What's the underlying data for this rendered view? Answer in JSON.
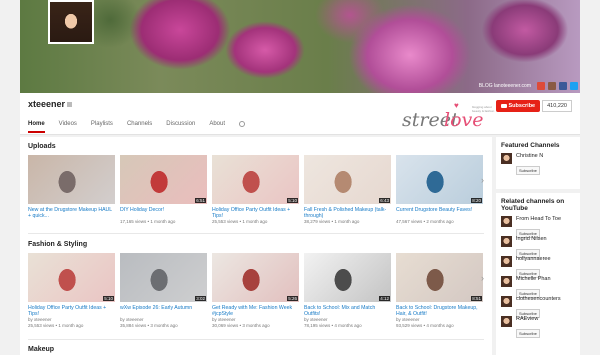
{
  "banner": {
    "blog_text": "BLOG lanoteeener.com",
    "social": [
      "g+",
      "ig",
      "f",
      "tw"
    ]
  },
  "channel": {
    "name": "xteeener",
    "tabs": [
      "Home",
      "Videos",
      "Playlists",
      "Channels",
      "Discussion",
      "About"
    ],
    "active_tab": "Home",
    "subscribe_label": "Subscribe",
    "subscriber_count": "410,220",
    "logo_street": "street",
    "logo_love": "love",
    "logo_tagline": "blogging about beauty & fashion"
  },
  "sections": [
    {
      "title": "Uploads",
      "videos": [
        {
          "title": "New at the Drugstore Makeup HAUL + quick...",
          "meta1": "",
          "meta2": "",
          "duration": "",
          "colors": [
            "#c9b6a8",
            "#7a6c6a"
          ]
        },
        {
          "title": "DIY Holiday Decor!",
          "meta1": "17,165 views • 1 month ago",
          "meta2": "",
          "duration": "6:51",
          "colors": [
            "#d6c8b8",
            "#c23a3a"
          ]
        },
        {
          "title": "Holiday Office Party Outfit Ideas + Tips!",
          "meta1": "25,553 views • 1 month ago",
          "meta2": "",
          "duration": "5:10",
          "colors": [
            "#e9e1d6",
            "#c0504d"
          ]
        },
        {
          "title": "Fall Fresh & Polished Makeup (talk-through)",
          "meta1": "38,279 views • 1 month ago",
          "meta2": "",
          "duration": "6:43",
          "colors": [
            "#eee6df",
            "#b58a72"
          ]
        },
        {
          "title": "Current Drugstore Beauty Faves!",
          "meta1": "47,567 views • 2 months ago",
          "meta2": "",
          "duration": "8:20",
          "colors": [
            "#d9e3ec",
            "#2f6a96"
          ]
        }
      ]
    },
    {
      "title": "Fashion & Styling",
      "videos": [
        {
          "title": "Holiday Office Party Outfit Ideas + Tips!",
          "meta1": "by xteeener",
          "meta2": "25,553 views • 1 month ago",
          "duration": "5:10",
          "colors": [
            "#e9e1d6",
            "#c0504d"
          ]
        },
        {
          "title": "wXw Episode 26: Early Autumn",
          "meta1": "by xteeener",
          "meta2": "35,884 views • 3 months ago",
          "duration": "3:02",
          "colors": [
            "#b9bcc0",
            "#6c6e72"
          ]
        },
        {
          "title": "Get Ready with Me: Fashion Week #jcpStyle",
          "meta1": "by xteeener",
          "meta2": "30,069 views • 3 months ago",
          "duration": "5:26",
          "colors": [
            "#ece7e2",
            "#a7413d"
          ]
        },
        {
          "title": "Back to School: Mix and Match Outfits!",
          "meta1": "by xteeener",
          "meta2": "78,195 views • 4 months ago",
          "duration": "4:12",
          "colors": [
            "#f2f2f2",
            "#4c4c4c"
          ]
        },
        {
          "title": "Back to School: Drugstore Makeup, Hair, & Outfit!",
          "meta1": "by xteeener",
          "meta2": "93,529 views • 4 months ago",
          "duration": "8:51",
          "colors": [
            "#e7ddd2",
            "#7d5a4a"
          ]
        }
      ]
    },
    {
      "title": "Makeup",
      "videos": []
    }
  ],
  "featured": {
    "title": "Featured Channels",
    "channels": [
      {
        "name": "Christine N",
        "btn": "Subscribe"
      }
    ]
  },
  "related": {
    "title": "Related channels on YouTube",
    "channels": [
      {
        "name": "From Head To Toe",
        "btn": "Subscribe"
      },
      {
        "name": "Ingrid Nilsen",
        "btn": "Subscribe"
      },
      {
        "name": "hollyannaeree",
        "btn": "Subscribe"
      },
      {
        "name": "Michelle Phan",
        "btn": "Subscribe"
      },
      {
        "name": "clothesencounters",
        "btn": "Subscribe"
      },
      {
        "name": "RAEview",
        "btn": "Subscribe"
      }
    ]
  },
  "colors": {
    "accent": "#e62117",
    "link": "#167ac6",
    "logo_pink": "#e64f76"
  }
}
